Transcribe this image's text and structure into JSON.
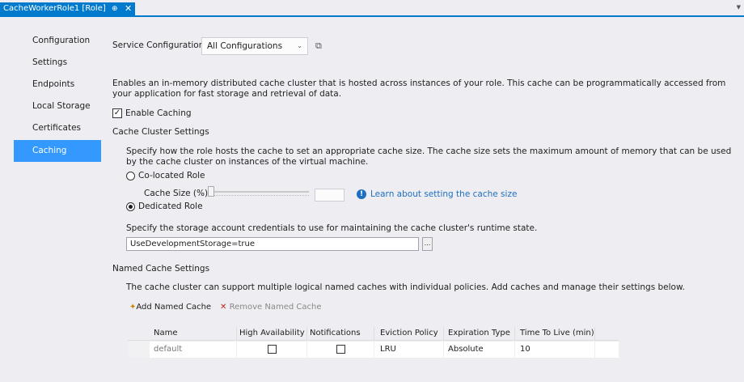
{
  "tab": {
    "title": "CacheWorkerRole1 [Role]",
    "pin_glyph": "⊕",
    "close_glyph": "✕"
  },
  "nav": [
    {
      "label": "Configuration"
    },
    {
      "label": "Settings"
    },
    {
      "label": "Endpoints"
    },
    {
      "label": "Local Storage"
    },
    {
      "label": "Certificates"
    },
    {
      "label": "Caching",
      "active": true
    }
  ],
  "service_config": {
    "label": "Service Configuration:",
    "selected": "All Configurations"
  },
  "description": "Enables an in-memory distributed cache cluster that is hosted across instances of your role. This cache can be programmatically accessed from your application for fast storage and retrieval of data.",
  "enable_caching": {
    "label": "Enable Caching",
    "checked": true
  },
  "cluster": {
    "heading": "Cache Cluster Settings",
    "description": "Specify how the role hosts the cache to set an appropriate cache size. The cache size sets the maximum amount of memory that can be used by the cache cluster on instances of the virtual machine.",
    "colocated_label": "Co-located Role",
    "cache_size_label": "Cache Size (%):",
    "cache_size_value": "",
    "learn_link": "Learn about setting the cache size",
    "dedicated_label": "Dedicated Role",
    "selected_mode": "dedicated",
    "storage_description": "Specify the storage account credentials to use for maintaining the cache cluster's runtime state.",
    "storage_value": "UseDevelopmentStorage=true",
    "browse_label": "..."
  },
  "named": {
    "heading": "Named Cache Settings",
    "description": "The cache cluster can support multiple logical named caches with individual policies. Add caches and manage their settings below.",
    "add_label": "Add Named Cache",
    "remove_label": "Remove Named Cache",
    "columns": [
      "Name",
      "High Availability",
      "Notifications",
      "Eviction Policy",
      "Expiration Type",
      "Time To Live (min)"
    ],
    "rows": [
      {
        "name": "default",
        "high_availability": false,
        "notifications": false,
        "eviction": "LRU",
        "expiration": "Absolute",
        "ttl": "10"
      }
    ]
  },
  "colors": {
    "accent": "#007acc",
    "nav_active": "#3399ff",
    "link": "#1e6fc2",
    "remove": "#c42b1c"
  }
}
